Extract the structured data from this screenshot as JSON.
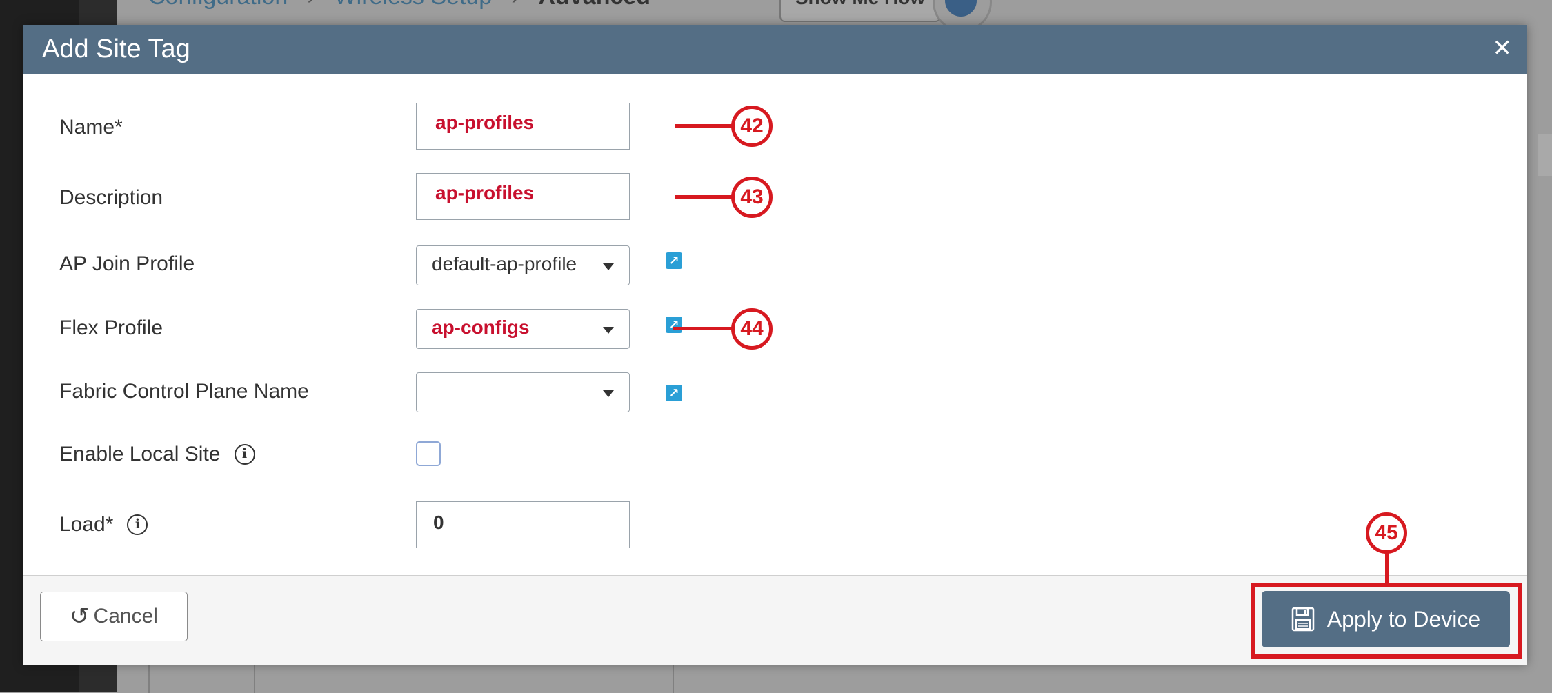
{
  "background": {
    "breadcrumb": [
      "Configuration",
      "Wireless Setup",
      "Advanced"
    ],
    "show_me_how": "Show Me How"
  },
  "modal": {
    "title": "Add Site Tag",
    "close_icon": "close-icon",
    "fields": {
      "name": {
        "label": "Name*",
        "value": "ap-profiles"
      },
      "description": {
        "label": "Description",
        "value": "ap-profiles"
      },
      "ap_join_profile": {
        "label": "AP Join Profile",
        "value": "default-ap-profile"
      },
      "flex_profile": {
        "label": "Flex Profile",
        "value": "ap-configs"
      },
      "fabric_control_plane": {
        "label": "Fabric Control Plane Name",
        "value": ""
      },
      "enable_local_site": {
        "label": "Enable Local Site",
        "checked": false
      },
      "load": {
        "label": "Load*",
        "value": "0"
      }
    },
    "footer": {
      "cancel_label": "Cancel",
      "apply_label": "Apply to Device"
    }
  },
  "annotations": {
    "name": "42",
    "description": "43",
    "flex_profile": "44",
    "apply": "45"
  },
  "colors": {
    "header": "#546e85",
    "annotation_red": "#d71920",
    "value_red": "#c8102e",
    "link_icon_blue": "#2a9fd6"
  }
}
